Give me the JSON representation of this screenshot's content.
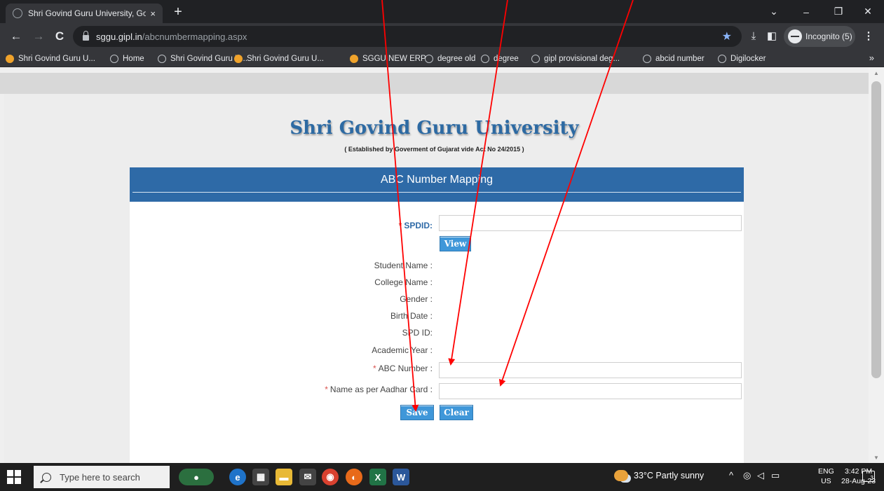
{
  "browser": {
    "tab_title": "Shri Govind Guru University, God",
    "tab_close": "×",
    "new_tab": "+",
    "url_host": "sggu.gipl.in",
    "url_path": "/abcnumbermapping.aspx",
    "profile_label": "Incognito (5)",
    "more_label": "⋮",
    "bookmarks": [
      {
        "label": "Shri Govind Guru U...",
        "icon": "sun"
      },
      {
        "label": "Home",
        "icon": "globe"
      },
      {
        "label": "Shri Govind Guru U...",
        "icon": "globe"
      },
      {
        "label": "Shri Govind Guru U...",
        "icon": "sun"
      },
      {
        "label": "SGGU NEW ERP",
        "icon": "sun"
      },
      {
        "label": "degree old",
        "icon": "globe"
      },
      {
        "label": "degree",
        "icon": "globe"
      },
      {
        "label": "gipl provisional deg...",
        "icon": "globe"
      },
      {
        "label": "abcid number",
        "icon": "globe"
      },
      {
        "label": "Digilocker",
        "icon": "globe"
      }
    ],
    "bookmarks_more": "»"
  },
  "page": {
    "university_name": "Shri Govind Guru University",
    "established_line": "( Established by Goverment of Gujarat vide Act No 24/2015 )",
    "panel_title": "ABC Number Mapping",
    "spdid_label": "SPDID:",
    "required_mark": "*",
    "spdid_value": "",
    "view_button": "View",
    "info_labels": [
      "Student Name :",
      "College Name :",
      "Gender :",
      "Birth Date :",
      "SPD ID:",
      "Academic Year :"
    ],
    "abc_label": "ABC Number :",
    "abc_value": "",
    "aadhar_label": "Name as per Aadhar Card :",
    "aadhar_value": "",
    "save_button": "Save",
    "clear_button": "Clear"
  },
  "taskbar": {
    "search_placeholder": "Type here to search",
    "weather": "33°C  Partly sunny",
    "lang_top": "ENG",
    "lang_bottom": "US",
    "time": "3:42 PM",
    "date": "28-Aug-23",
    "notification_count": "3"
  },
  "colors": {
    "accent_blue": "#2e6aa7",
    "button_blue": "#3f97d9",
    "required_red": "#d9534f",
    "arrow_red": "#ff0000"
  }
}
